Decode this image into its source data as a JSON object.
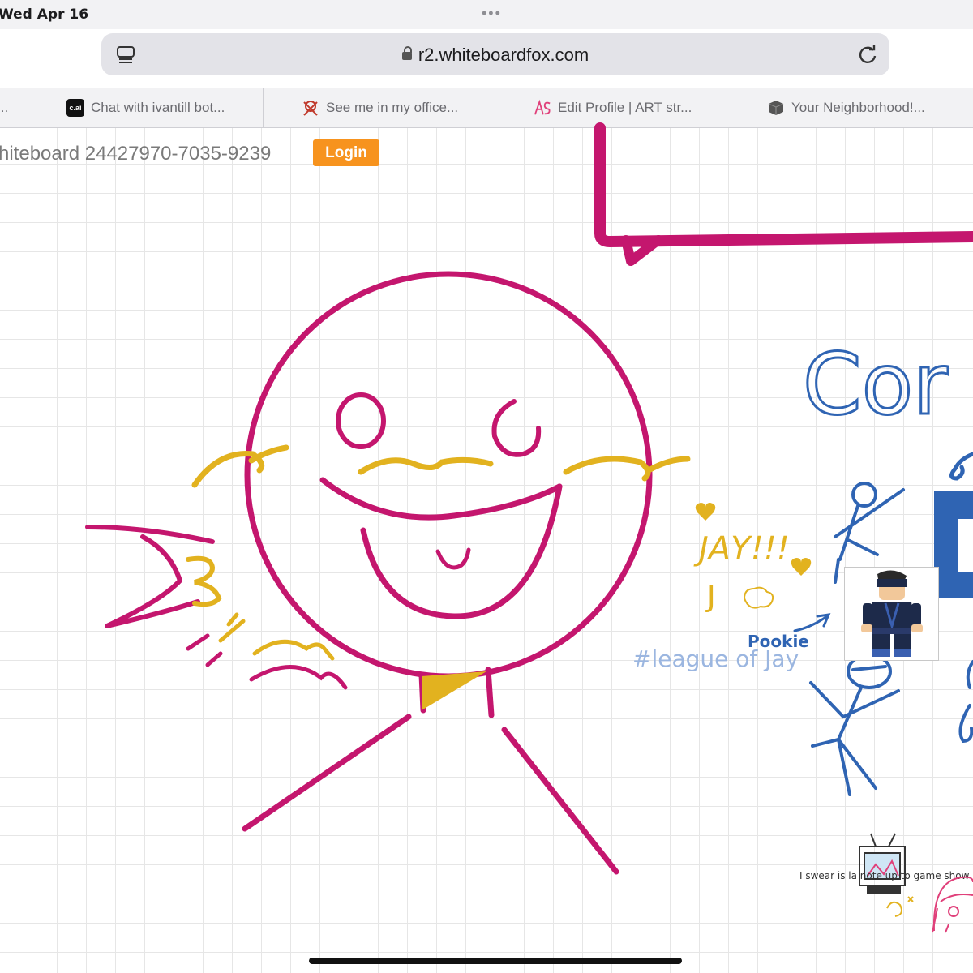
{
  "status": {
    "time": "Wed Apr 16",
    "dots": "•••"
  },
  "browser": {
    "url": "r2.whiteboardfox.com",
    "tabs": [
      {
        "label": "...",
        "icon": "blank-icon"
      },
      {
        "label": "Chat with ivantill bot...",
        "icon": "character-ai-icon"
      },
      {
        "label": "See me in my office...",
        "icon": "skull-icon"
      },
      {
        "label": "Edit Profile | ART str...",
        "icon": "artstreet-icon"
      },
      {
        "label": "Your Neighborhood!...",
        "icon": "cube-icon"
      }
    ]
  },
  "board": {
    "title": "hiteboard 24427970-7035-9239",
    "login_label": "Login"
  },
  "doodles": {
    "jay_text": "JAY!!!",
    "j_text": "J",
    "hashtag_text": "#league of Jay",
    "pookie_text": "Pookie",
    "blue_word": "Cor",
    "small_note": "I swear is la note up to game show music"
  },
  "colors": {
    "magenta": "#c4166e",
    "gold": "#e2b21f",
    "blue": "#2f64b3",
    "orange": "#f7931e"
  }
}
